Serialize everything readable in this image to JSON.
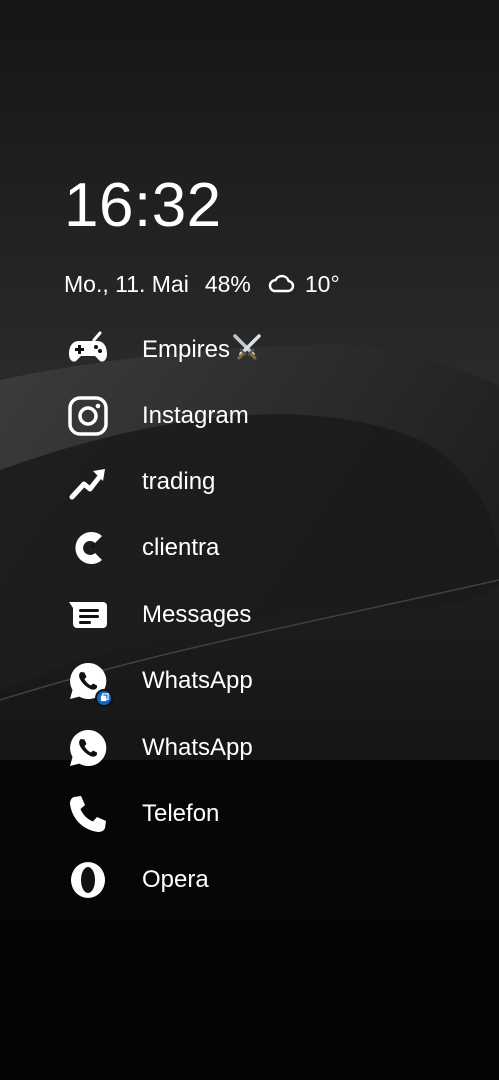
{
  "status": {
    "time": "16:32",
    "date": "Mo., 11. Mai",
    "battery": "48%",
    "weather_icon": "cloud-icon",
    "temperature": "10°"
  },
  "apps": [
    {
      "label": "Empires",
      "icon": "gamepad-icon",
      "suffix_icon": "crossed-swords-icon"
    },
    {
      "label": "Instagram",
      "icon": "instagram-icon"
    },
    {
      "label": "trading",
      "icon": "trending-up-icon"
    },
    {
      "label": "clientra",
      "icon": "clientra-icon"
    },
    {
      "label": "Messages",
      "icon": "message-icon"
    },
    {
      "label": "WhatsApp",
      "icon": "whatsapp-icon",
      "badge_icon": "clone-app-badge-icon"
    },
    {
      "label": "WhatsApp",
      "icon": "whatsapp-icon"
    },
    {
      "label": "Telefon",
      "icon": "phone-icon"
    },
    {
      "label": "Opera",
      "icon": "opera-icon"
    }
  ],
  "colors": {
    "background": "#070707",
    "text": "#ffffff",
    "badge": "#1565c0"
  }
}
